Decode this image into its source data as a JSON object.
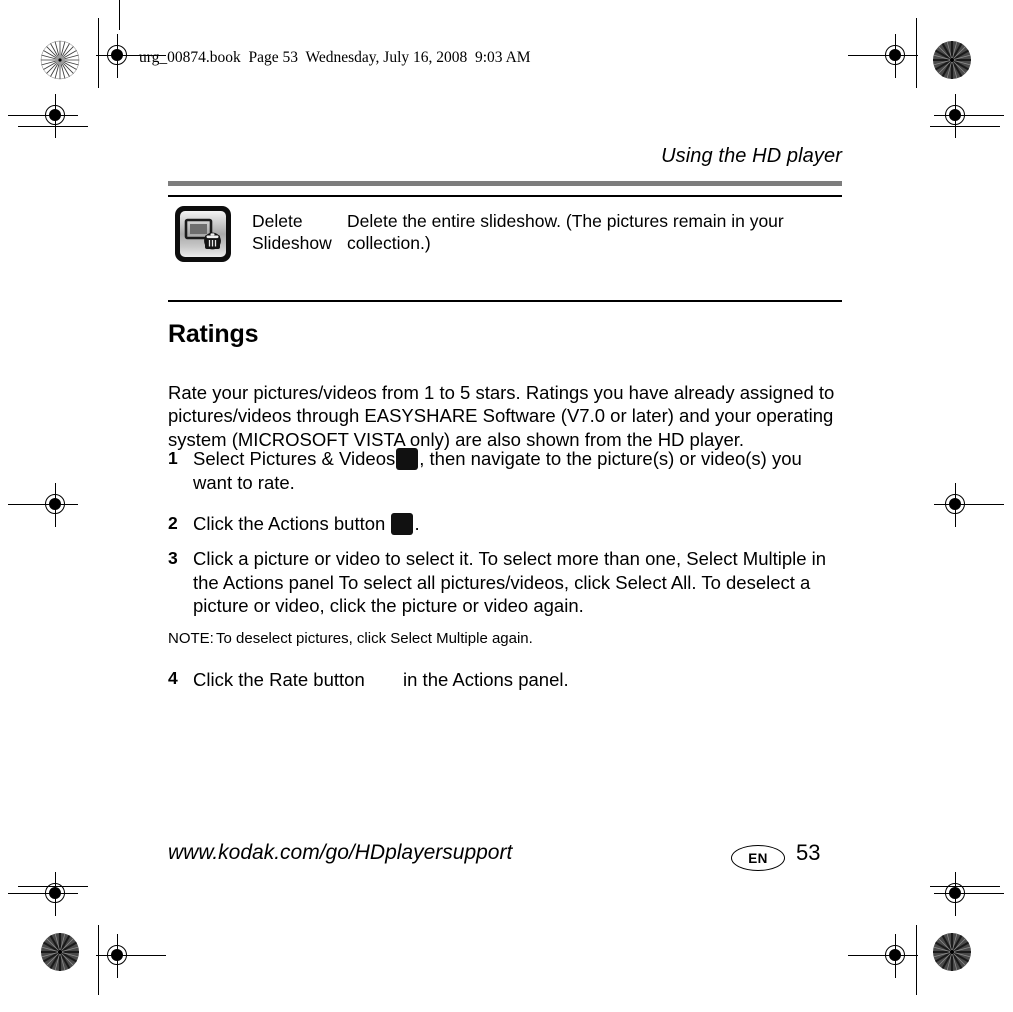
{
  "print_marks": {
    "book_line": "urg_00874.book  Page 53  Wednesday, July 16, 2008  9:03 AM"
  },
  "header": {
    "running_head": "Using the HD player"
  },
  "icon_table": {
    "rows": [
      {
        "icon_name": "delete-slideshow-icon",
        "name": "Delete Slideshow",
        "name_line1": "Delete",
        "name_line2": "Slideshow",
        "description": "Delete the entire slideshow. (The pictures remain in your collection.)"
      }
    ]
  },
  "section": {
    "heading": "Ratings",
    "intro": "Rate your pictures/videos from 1 to 5 stars. Ratings you have already assigned to pictures/videos through EASYSHARE Software (V7.0 or later) and your operating system (MICROSOFT VISTA only) are also shown from the HD player.",
    "steps": [
      {
        "number": "1",
        "text_before": "Select Pictures & Videos",
        "icon_name": "pictures-and-videos-icon",
        "text_after": ", then navigate to the picture(s) or video(s) you want to rate."
      },
      {
        "number": "2",
        "text_before": "Click the Actions button",
        "icon_name": "actions-button-icon",
        "text_after": "."
      },
      {
        "number": "3",
        "text_before": "Click a picture or video to select it. To select more than one, Select Multiple in the Actions panel To select all pictures/videos, click Select All. To deselect a picture or video, click the picture or video again.",
        "icon_name": "",
        "text_after": ""
      },
      {
        "number": "4",
        "text_before": "Click the Rate button",
        "icon_name": "rate-button-icon",
        "text_after": "in the Actions panel."
      }
    ],
    "note": {
      "label": "NOTE:",
      "text": "To deselect pictures, click Select Multiple again."
    }
  },
  "footer": {
    "url": "www.kodak.com/go/HDplayersupport",
    "language": "EN",
    "page_number": "53"
  },
  "colors": {
    "header_rule": "#7d7d7d",
    "text": "#000000",
    "icon_frame": "#0d0d0d"
  }
}
